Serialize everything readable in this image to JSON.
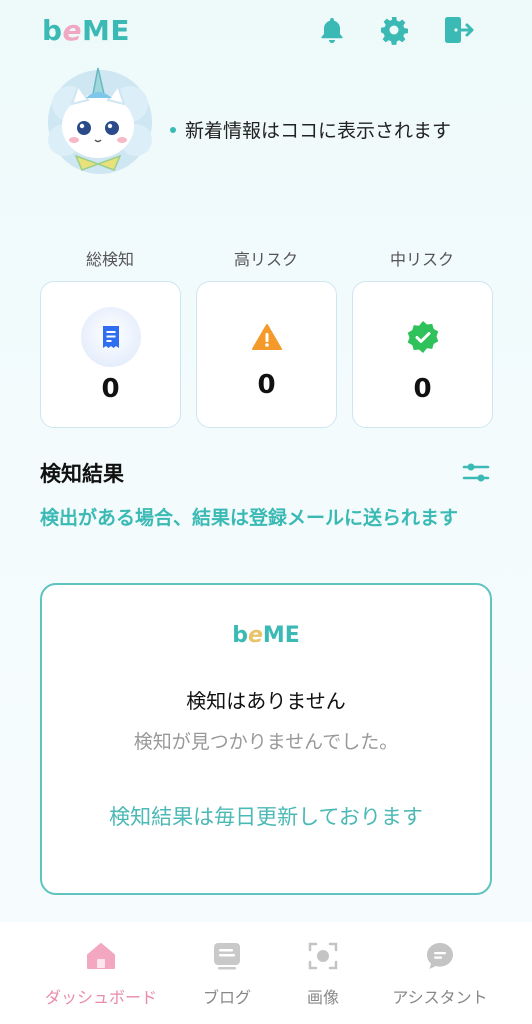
{
  "header": {
    "logo_b": "b",
    "logo_e": "e",
    "logo_me": "ME",
    "icons": [
      "bell-icon",
      "gear-icon",
      "logout-icon"
    ],
    "accent": "#3bbab5"
  },
  "news": {
    "text": "新着情報はココに表示されます"
  },
  "stats": [
    {
      "label": "総検知",
      "value": "0",
      "icon": "receipt-icon",
      "color": "#2f6ef0"
    },
    {
      "label": "高リスク",
      "value": "0",
      "icon": "warning-icon",
      "color": "#f39a2b"
    },
    {
      "label": "中リスク",
      "value": "0",
      "icon": "check-badge-icon",
      "color": "#2fc25b"
    }
  ],
  "results": {
    "title": "検知結果",
    "subtitle": "検出がある場合、結果は登録メールに送られます",
    "card_logo_b": "b",
    "card_logo_e": "e",
    "card_logo_me": "ME",
    "empty_title": "検知はありません",
    "empty_sub": "検知が見つかりませんでした。",
    "note": "検知結果は毎日更新しております"
  },
  "nav": [
    {
      "label": "ダッシュボード",
      "icon": "home-icon",
      "active": true
    },
    {
      "label": "ブログ",
      "icon": "blog-icon",
      "active": false
    },
    {
      "label": "画像",
      "icon": "image-scan-icon",
      "active": false
    },
    {
      "label": "アシスタント",
      "icon": "chat-icon",
      "active": false
    }
  ]
}
